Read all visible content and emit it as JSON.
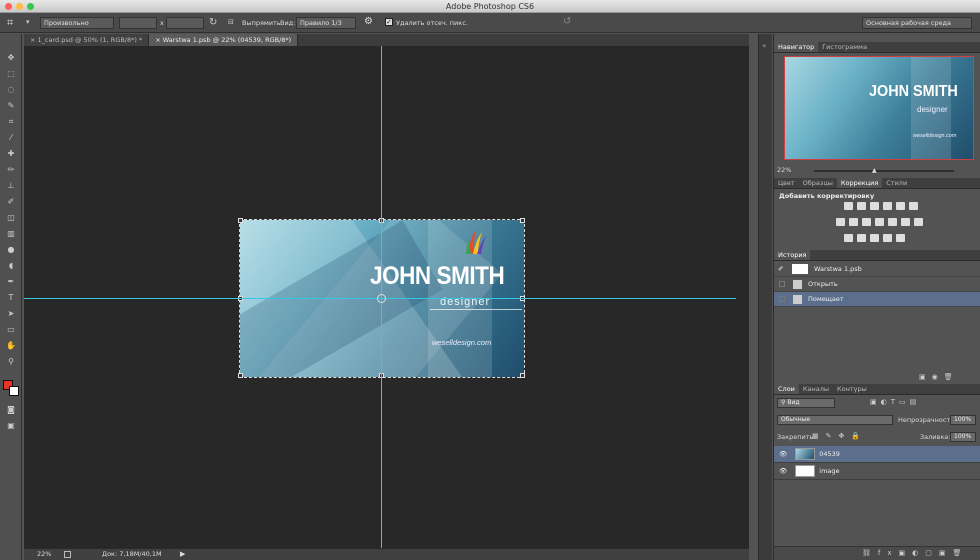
{
  "app": {
    "title": "Adobe Photoshop CS6"
  },
  "options_bar": {
    "ratio_preset": "Произвольно",
    "x_sep": "x",
    "straighten_label": "Выпрямить",
    "view_label": "Вид:",
    "view_value": "Правило 1/3",
    "delete_pixels_label": "Удалить отсеч. пикс.",
    "workspace": "Основная рабочая среда"
  },
  "doc_tabs": [
    {
      "label": "1_card.psd @ 50% (1, RGB/8*) *"
    },
    {
      "label": "Warstwa 1.psb @ 22% (04539, RGB/8*)"
    }
  ],
  "card": {
    "name": "JOHN SMITH",
    "role": "designer",
    "website": "weselldesign.com"
  },
  "status": {
    "zoom": "22%",
    "doc_size": "Док: 7,18M/40,1M"
  },
  "navigator": {
    "tabs": [
      "Навигатор",
      "Гистограмма"
    ],
    "zoom": "22%"
  },
  "adjust": {
    "tabs": [
      "Цвет",
      "Образцы",
      "Коррекция",
      "Стили"
    ],
    "title": "Добавить корректировку"
  },
  "history": {
    "tab": "История",
    "snapshot": "Warstwa 1.psb",
    "items": [
      "Открыть",
      "Помещает"
    ]
  },
  "layers": {
    "tabs": [
      "Слои",
      "Каналы",
      "Контуры"
    ],
    "kind": "Вид",
    "blend": "Обычные",
    "opacity_label": "Непрозрачность:",
    "opacity": "100%",
    "lock_label": "Закрепить:",
    "fill_label": "Заливка:",
    "fill": "100%",
    "items": [
      {
        "name": "04539"
      },
      {
        "name": "image"
      }
    ]
  },
  "colors": {
    "foreground": "#e8322a",
    "background": "#ffffff",
    "guide": "#39c6e0"
  }
}
